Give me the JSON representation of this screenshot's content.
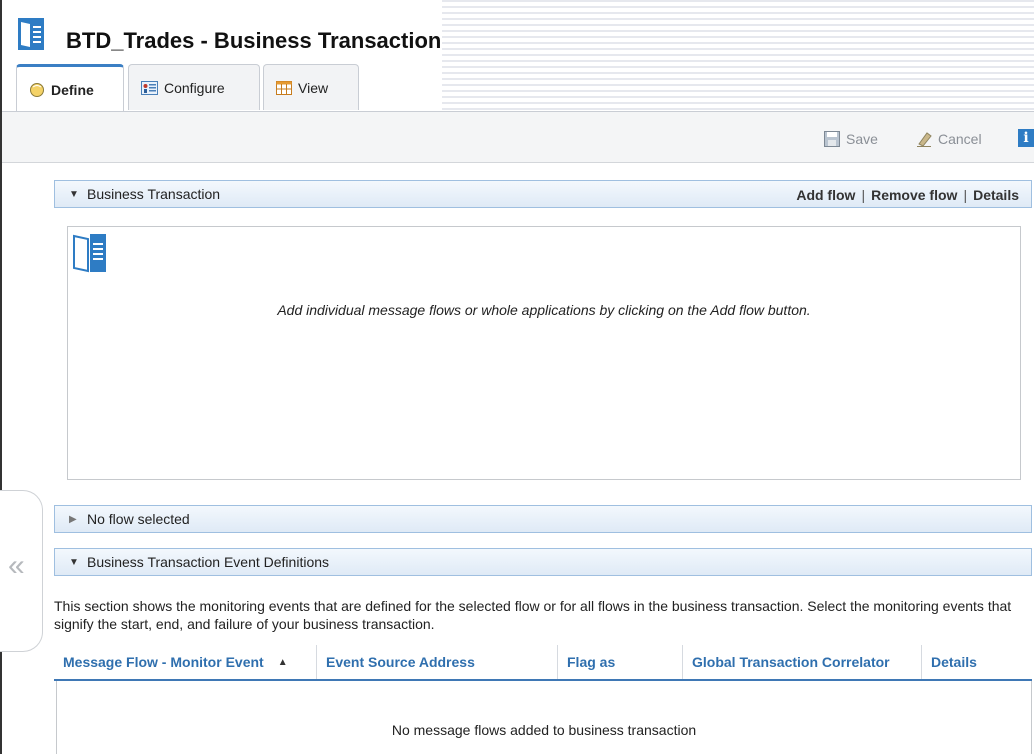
{
  "header": {
    "title": "BTD_Trades - Business Transaction"
  },
  "tabs": [
    {
      "label": "Define",
      "icon": "define-icon",
      "active": true
    },
    {
      "label": "Configure",
      "icon": "configure-icon",
      "active": false
    },
    {
      "label": "View",
      "icon": "table-view-icon",
      "active": false
    }
  ],
  "toolbar": {
    "save_label": "Save",
    "cancel_label": "Cancel",
    "info_label": "i"
  },
  "business_transaction": {
    "label": "Business Transaction",
    "links": {
      "add_flow": "Add flow",
      "remove_flow": "Remove flow",
      "details": "Details",
      "separator": "|"
    },
    "empty_message": "Add individual message flows or whole applications by clicking on the Add flow button."
  },
  "flow_section": {
    "label": "No flow selected"
  },
  "events_section": {
    "label": "Business Transaction Event Definitions",
    "description": "This section shows the monitoring events that are defined for the selected flow or for all flows in the business transaction. Select the monitoring events that signify the start, end, and failure of your business transaction."
  },
  "table": {
    "columns": [
      "Message Flow - Monitor Event",
      "Event Source Address",
      "Flag as",
      "Global Transaction Correlator",
      "Details"
    ],
    "sort_indicator": "▲",
    "empty_message": "No message flows added to business transaction"
  },
  "colors": {
    "accent": "#3b7fc4",
    "header_text": "#2f6fae",
    "section_border": "#9fbfe0"
  }
}
